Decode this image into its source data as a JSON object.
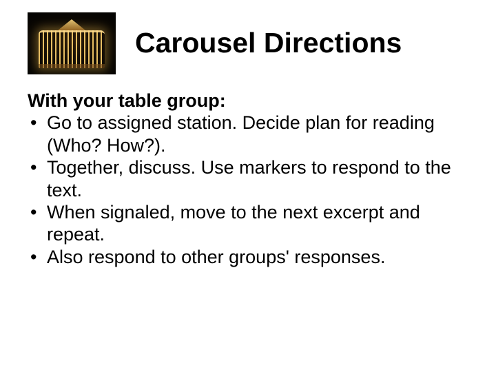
{
  "slide": {
    "title": "Carousel Directions",
    "intro": "With your table group:",
    "bullets": [
      "Go to assigned station. Decide plan for reading (Who? How?).",
      "Together, discuss. Use markers to respond to the text.",
      "When signaled, move to the  next excerpt and repeat.",
      "Also respond to other groups' responses."
    ]
  }
}
